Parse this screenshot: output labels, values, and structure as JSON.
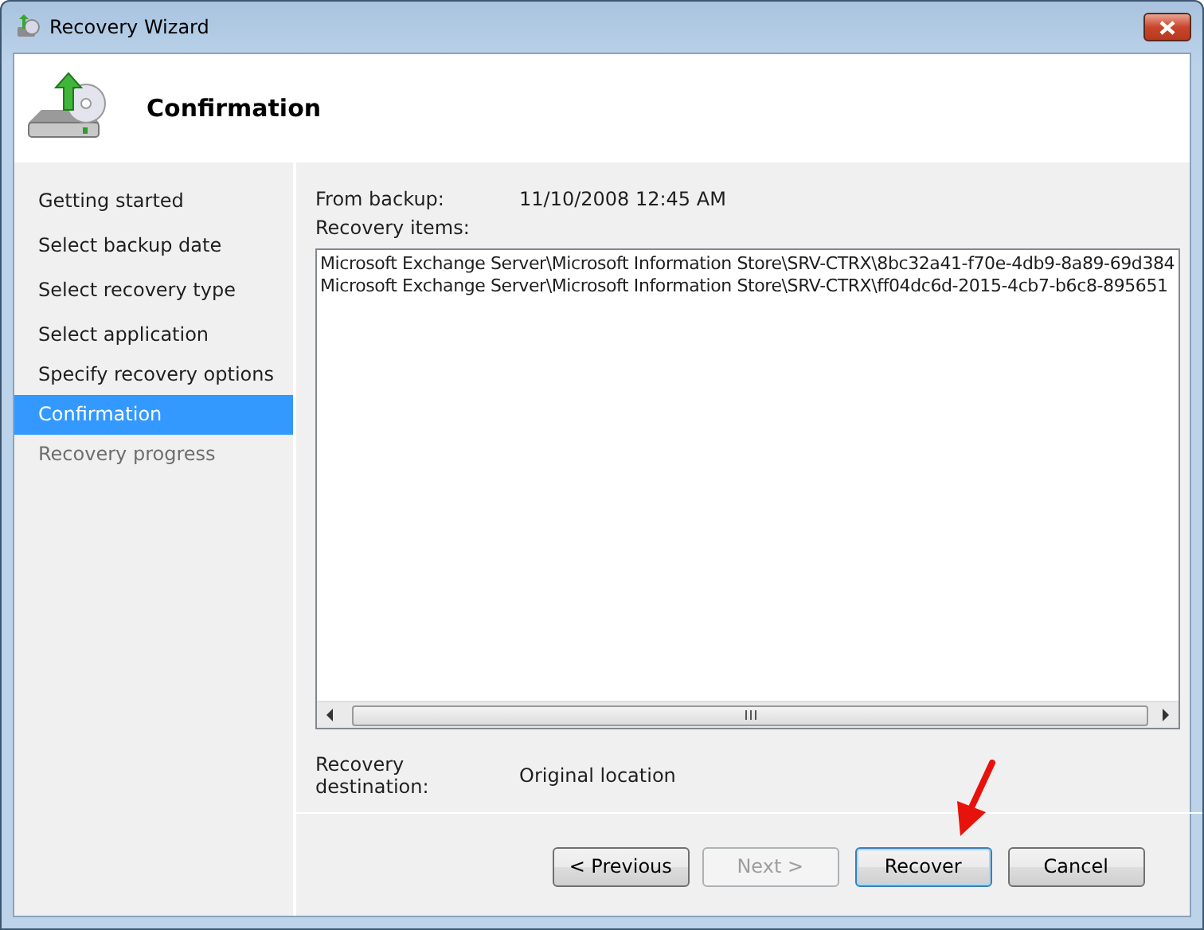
{
  "window": {
    "title": "Recovery Wizard"
  },
  "header": {
    "title": "Confirmation"
  },
  "steps": [
    {
      "label": "Getting started",
      "selected": false,
      "disabled": false
    },
    {
      "label": "Select backup date",
      "selected": false,
      "disabled": false
    },
    {
      "label": "Select recovery type",
      "selected": false,
      "disabled": false
    },
    {
      "label": "Select application",
      "selected": false,
      "disabled": false
    },
    {
      "label": "Specify recovery options",
      "selected": false,
      "disabled": false
    },
    {
      "label": "Confirmation",
      "selected": true,
      "disabled": false
    },
    {
      "label": "Recovery progress",
      "selected": false,
      "disabled": true
    }
  ],
  "summary": {
    "from_backup_label": "From backup:",
    "from_backup_value": "11/10/2008 12:45 AM",
    "items_label": "Recovery items:",
    "items": [
      "Microsoft Exchange Server\\Microsoft Information Store\\SRV-CTRX\\8bc32a41-f70e-4db9-8a89-69d384",
      "Microsoft Exchange Server\\Microsoft Information Store\\SRV-CTRX\\ff04dc6d-2015-4cb7-b6c8-895651"
    ],
    "destination_label": "Recovery destination:",
    "destination_value": "Original location"
  },
  "buttons": [
    {
      "label": "< Previous",
      "disabled": false,
      "default": false
    },
    {
      "label": "Next >",
      "disabled": true,
      "default": false
    },
    {
      "label": "Recover",
      "disabled": false,
      "default": true
    },
    {
      "label": "Cancel",
      "disabled": false,
      "default": false
    }
  ]
}
